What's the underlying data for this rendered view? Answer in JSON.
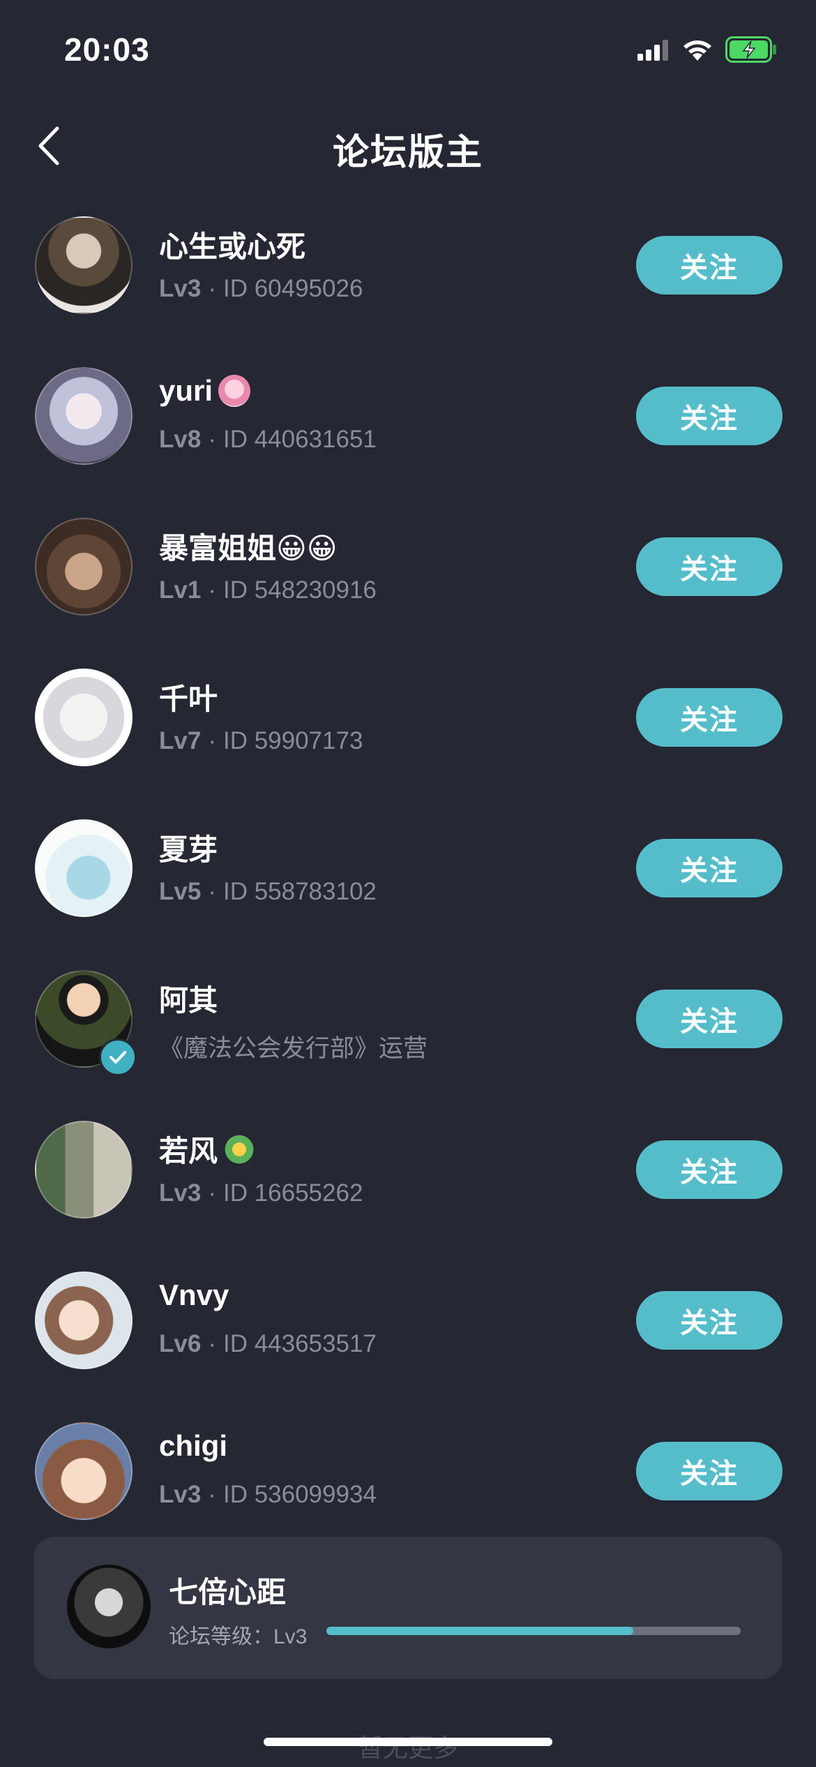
{
  "status_bar": {
    "time": "20:03",
    "icons": [
      "cellular-signal-icon",
      "wifi-icon",
      "battery-charging-icon"
    ]
  },
  "header": {
    "back_icon": "chevron-left-icon",
    "title": "论坛版主"
  },
  "colors": {
    "background": "#252733",
    "accent": "#55bdca",
    "card": "#343643",
    "secondary_text": "#8a8d99"
  },
  "users": [
    {
      "name": "心生或心死",
      "level": "Lv3",
      "sep": "·",
      "id": "ID 60495026",
      "follow_label": "关注"
    },
    {
      "name": "yuri",
      "level": "Lv8",
      "sep": "·",
      "id": "ID 440631651",
      "follow_label": "关注",
      "badge": "anime-sticker-icon"
    },
    {
      "name": "暴富姐姐😀😀",
      "level": "Lv1",
      "sep": "·",
      "id": "ID 548230916",
      "follow_label": "关注"
    },
    {
      "name": "千叶",
      "level": "Lv7",
      "sep": "·",
      "id": "ID 59907173",
      "follow_label": "关注"
    },
    {
      "name": "夏芽",
      "level": "Lv5",
      "sep": "·",
      "id": "ID 558783102",
      "follow_label": "关注"
    },
    {
      "name": "阿其",
      "subtitle": "《魔法公会发行部》运营",
      "follow_label": "关注",
      "verified": true
    },
    {
      "name": "若风",
      "level": "Lv3",
      "sep": "·",
      "id": "ID 16655262",
      "follow_label": "关注",
      "badge": "dragon-icon"
    },
    {
      "name": "Vnvy",
      "level": "Lv6",
      "sep": "·",
      "id": "ID 443653517",
      "follow_label": "关注"
    },
    {
      "name": "chigi",
      "level": "Lv3",
      "sep": "·",
      "id": "ID 536099934",
      "follow_label": "关注"
    }
  ],
  "my_card": {
    "name": "七倍心距",
    "level_label": "论坛等级：Lv3",
    "level_progress": 0.74
  },
  "footer": {
    "no_more": "暂无更多"
  }
}
